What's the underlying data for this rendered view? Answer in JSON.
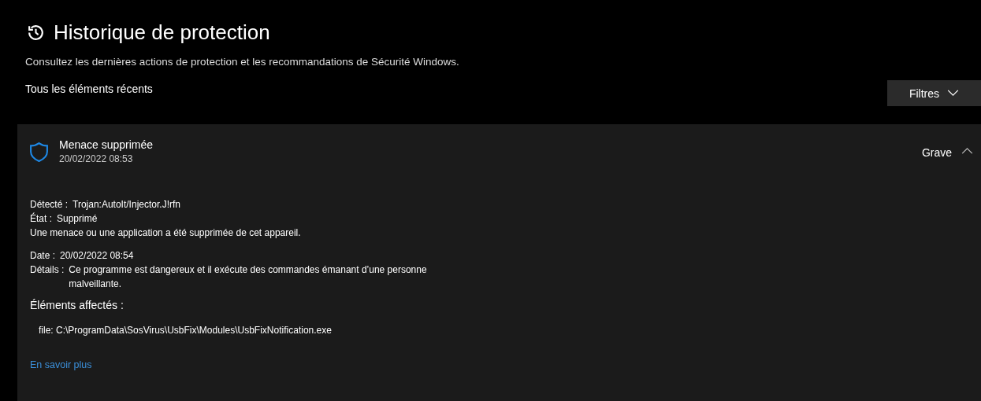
{
  "page": {
    "title": "Historique de protection",
    "subtitle": "Consultez les dernières actions de protection et les recommandations de Sécurité Windows.",
    "section_label": "Tous les éléments récents",
    "filter_button": "Filtres"
  },
  "events": [
    {
      "title": "Menace supprimée",
      "time": "20/02/2022 08:53",
      "severity": "Grave",
      "expanded": true,
      "status_fields": [
        {
          "label": "Détecté :",
          "value": "Trojan:AutoIt/Injector.J!rfn"
        },
        {
          "label": "État :",
          "value": "Supprimé"
        }
      ],
      "message": "Une menace ou une application a été supprimée de cet appareil.",
      "info_fields": [
        {
          "label": "Date :",
          "value": "20/02/2022 08:54"
        },
        {
          "label": "Détails :",
          "value": "Ce programme est dangereux et il exécute des commandes émanant d’une personne malveillante."
        }
      ],
      "affected_heading": "Éléments affectés :",
      "affected_items": [
        "file: C:\\ProgramData\\SosVirus\\UsbFix\\Modules\\UsbFixNotification.exe"
      ],
      "link": "En savoir plus"
    }
  ]
}
